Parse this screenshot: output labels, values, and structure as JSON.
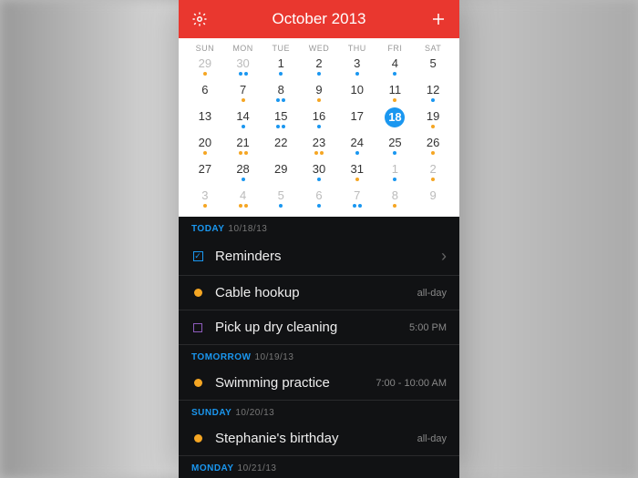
{
  "header": {
    "title": "October 2013"
  },
  "weekdays": [
    "SUN",
    "MON",
    "TUE",
    "WED",
    "THU",
    "FRI",
    "SAT"
  ],
  "days": [
    {
      "n": "29",
      "dim": true,
      "dots": [
        "o"
      ]
    },
    {
      "n": "30",
      "dim": true,
      "dots": [
        "b",
        "b"
      ]
    },
    {
      "n": "1",
      "dots": [
        "b"
      ]
    },
    {
      "n": "2",
      "dots": [
        "b"
      ]
    },
    {
      "n": "3",
      "dots": [
        "b"
      ]
    },
    {
      "n": "4",
      "dots": [
        "b"
      ]
    },
    {
      "n": "5",
      "dots": []
    },
    {
      "n": "6",
      "dots": []
    },
    {
      "n": "7",
      "dots": [
        "o"
      ]
    },
    {
      "n": "8",
      "dots": [
        "b",
        "b"
      ]
    },
    {
      "n": "9",
      "dots": [
        "o"
      ]
    },
    {
      "n": "10",
      "dots": []
    },
    {
      "n": "11",
      "dots": [
        "o"
      ]
    },
    {
      "n": "12",
      "dots": [
        "b"
      ]
    },
    {
      "n": "13",
      "dots": []
    },
    {
      "n": "14",
      "dots": [
        "b"
      ]
    },
    {
      "n": "15",
      "dots": [
        "b",
        "b"
      ]
    },
    {
      "n": "16",
      "dots": [
        "b"
      ]
    },
    {
      "n": "17",
      "dots": []
    },
    {
      "n": "18",
      "dots": [],
      "selected": true
    },
    {
      "n": "19",
      "dots": [
        "o"
      ]
    },
    {
      "n": "20",
      "dots": [
        "o"
      ]
    },
    {
      "n": "21",
      "dots": [
        "o",
        "o"
      ]
    },
    {
      "n": "22",
      "dots": []
    },
    {
      "n": "23",
      "dots": [
        "o",
        "o"
      ]
    },
    {
      "n": "24",
      "dots": [
        "b"
      ]
    },
    {
      "n": "25",
      "dots": [
        "b"
      ]
    },
    {
      "n": "26",
      "dots": [
        "o"
      ]
    },
    {
      "n": "27",
      "dots": []
    },
    {
      "n": "28",
      "dots": [
        "b"
      ]
    },
    {
      "n": "29",
      "dots": []
    },
    {
      "n": "30",
      "dots": [
        "b"
      ]
    },
    {
      "n": "31",
      "dots": [
        "o"
      ]
    },
    {
      "n": "1",
      "dim": true,
      "dots": [
        "b"
      ]
    },
    {
      "n": "2",
      "dim": true,
      "dots": [
        "o"
      ]
    },
    {
      "n": "3",
      "dim": true,
      "dots": [
        "o"
      ]
    },
    {
      "n": "4",
      "dim": true,
      "dots": [
        "o",
        "o"
      ]
    },
    {
      "n": "5",
      "dim": true,
      "dots": [
        "b"
      ]
    },
    {
      "n": "6",
      "dim": true,
      "dots": [
        "b"
      ]
    },
    {
      "n": "7",
      "dim": true,
      "dots": [
        "b",
        "b"
      ]
    },
    {
      "n": "8",
      "dim": true,
      "dots": [
        "o"
      ]
    },
    {
      "n": "9",
      "dim": true,
      "dots": []
    }
  ],
  "sections": [
    {
      "label": "TODAY",
      "date": "10/18/13",
      "items": [
        {
          "marker": "check",
          "title": "Reminders",
          "chevron": true
        },
        {
          "marker": "bullet",
          "title": "Cable hookup",
          "time": "all-day"
        },
        {
          "marker": "square",
          "title": "Pick up dry cleaning",
          "time": "5:00 PM"
        }
      ]
    },
    {
      "label": "TOMORROW",
      "date": "10/19/13",
      "items": [
        {
          "marker": "bullet",
          "title": "Swimming practice",
          "time": "7:00 - 10:00 AM"
        }
      ]
    },
    {
      "label": "SUNDAY",
      "date": "10/20/13",
      "items": [
        {
          "marker": "bullet",
          "title": "Stephanie's birthday",
          "time": "all-day"
        }
      ]
    },
    {
      "label": "MONDAY",
      "date": "10/21/13",
      "items": []
    }
  ]
}
